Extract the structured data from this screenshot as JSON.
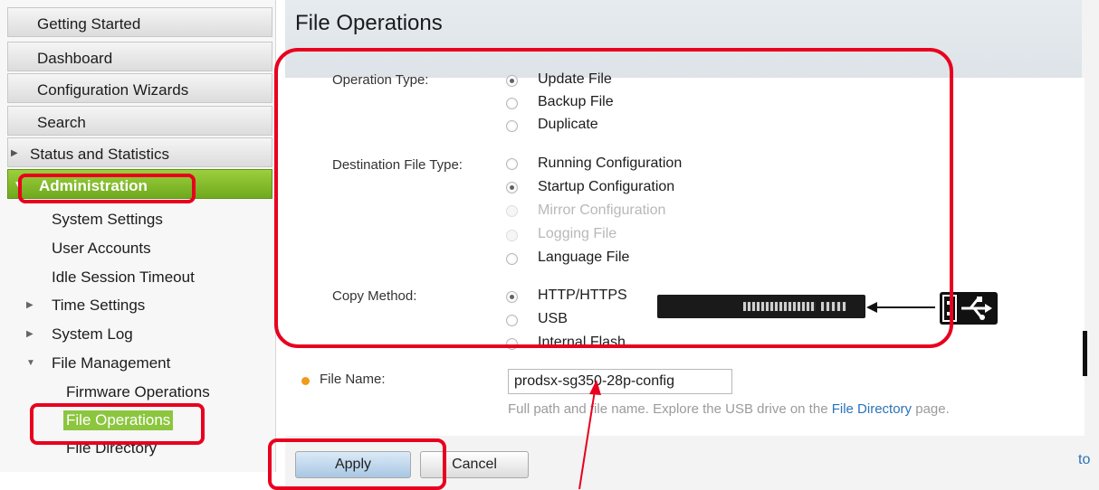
{
  "sidebar": {
    "top_items": [
      "Getting Started",
      "Dashboard",
      "Configuration Wizards",
      "Search",
      "Status and Statistics"
    ],
    "active_section": "Administration",
    "admin_items": [
      "System Settings",
      "User Accounts",
      "Idle Session Timeout",
      "Time Settings",
      "System Log",
      "File Management",
      "Firmware Operations",
      "File Operations",
      "File Directory"
    ]
  },
  "page": {
    "title": "File Operations"
  },
  "form": {
    "operation_type_label": "Operation Type:",
    "operation_options": [
      "Update File",
      "Backup File",
      "Duplicate"
    ],
    "operation_selected": "Update File",
    "dest_type_label": "Destination File Type:",
    "dest_options": [
      "Running Configuration",
      "Startup Configuration",
      "Mirror Configuration",
      "Logging File",
      "Language File"
    ],
    "dest_selected": "Startup Configuration",
    "dest_disabled": [
      "Mirror Configuration",
      "Logging File"
    ],
    "copy_method_label": "Copy Method:",
    "copy_options": [
      "HTTP/HTTPS",
      "USB",
      "Internal Flash"
    ],
    "copy_selected": "HTTP/HTTPS",
    "file_name_label": "File Name:",
    "file_name_value": "prodsx-sg350-28p-config",
    "hint_before": "Full path and file name. Explore the USB drive on the ",
    "hint_link": "File Directory",
    "hint_after": " page."
  },
  "buttons": {
    "apply": "Apply",
    "cancel": "Cancel"
  },
  "edge_text": "to",
  "colors": {
    "annotation_red": "#e8001f",
    "active_green": "#8cc63f",
    "link_blue": "#2a73b8",
    "required_orange": "#f19a1b"
  }
}
